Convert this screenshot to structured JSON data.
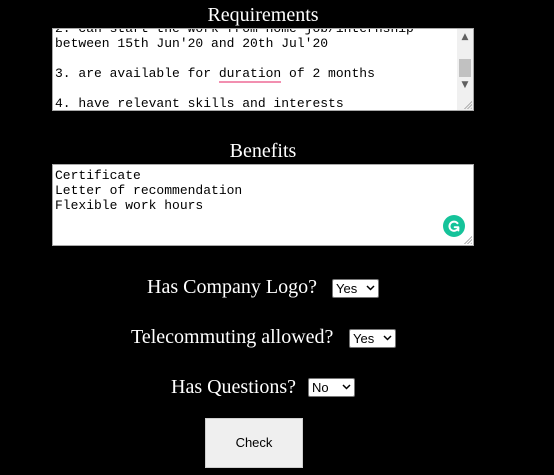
{
  "requirements": {
    "heading": "Requirements",
    "lines": [
      "2. can start the work from home job/internship",
      "between 15th Jun'20 and 20th Jul'20",
      "",
      "3. are available for ",
      "duration",
      " of 2 months",
      "",
      "4. have relevant skills and interests"
    ]
  },
  "benefits": {
    "heading": "Benefits",
    "lines": [
      "Certificate",
      "Letter of recommendation",
      "Flexible work hours"
    ]
  },
  "fields": {
    "company_logo": {
      "label": "Has Company Logo?",
      "value": "Yes"
    },
    "telecommuting": {
      "label": "Telecommuting allowed?",
      "value": "Yes"
    },
    "questions": {
      "label": "Has Questions?",
      "value": "No"
    }
  },
  "check_button": "Check",
  "icons": {
    "scroll_up": "scroll-up-arrow-icon",
    "scroll_down": "scroll-down-arrow-icon",
    "grammarly": "grammarly-icon",
    "dropdown": "chevron-down-icon"
  },
  "colors": {
    "background": "#000000",
    "grammarly": "#15c39a",
    "spell_underline": "#f28fb0"
  }
}
